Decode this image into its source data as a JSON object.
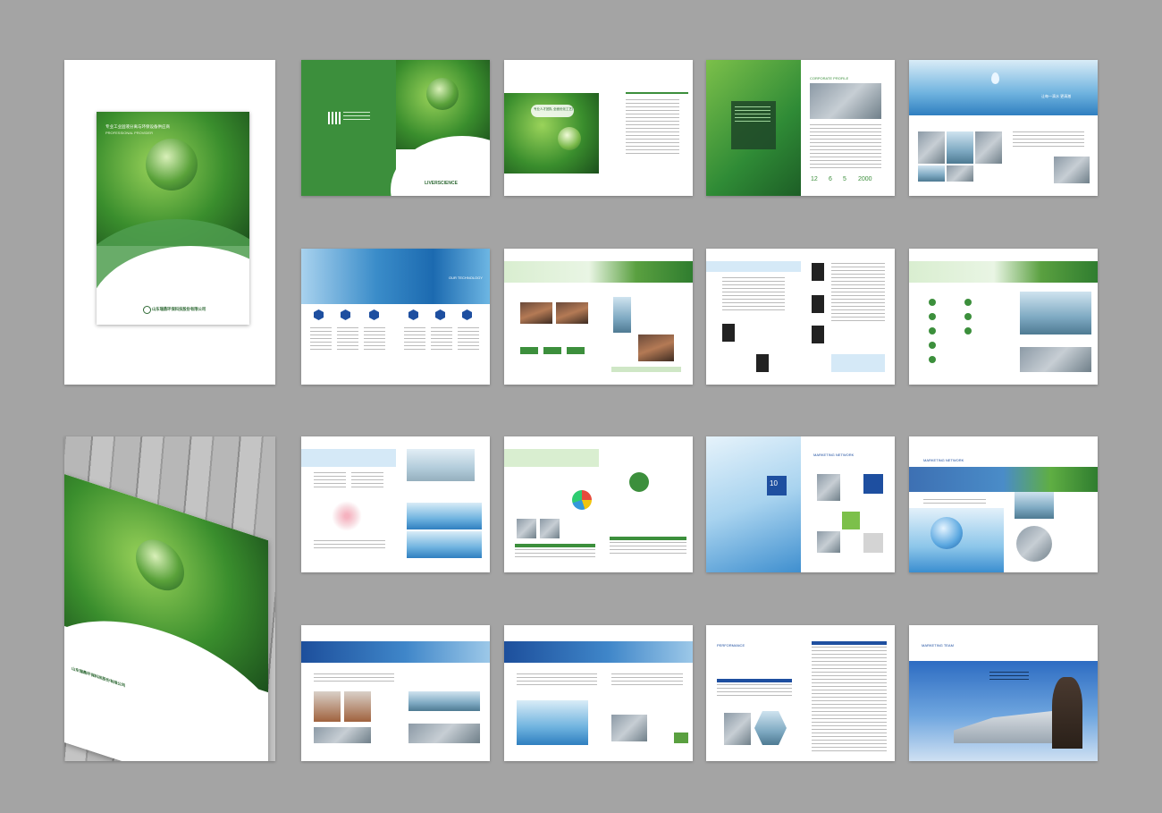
{
  "cover": {
    "company_cn": "山东瑞鼎环保科技股份有限公司",
    "title_cn": "专业工业固液分离与环保设备供应商",
    "title_en": "PROFESSIONAL PROVIDER",
    "back_logo": "LIVERSCIENCE"
  },
  "pages": {
    "p03_banner": "专业人才团队 全面优化工艺服务方案",
    "p04_heading": "CORPORATE PROFILE",
    "p04_stats": [
      "12",
      "6",
      "5",
      "2000"
    ],
    "p05_slogan": "让每一滴水 更清澈",
    "p06_heading": "OUR TECHNOLOGY",
    "p16_heading": "MARKETING NETWORK",
    "p17_number": "10",
    "p20_heading": "PERFORMANCE",
    "p22_heading": "MARKETING TEAM"
  },
  "colors": {
    "background": "#a4a4a4",
    "brand_green": "#3c8f3c",
    "brand_blue": "#1e4fa0"
  }
}
